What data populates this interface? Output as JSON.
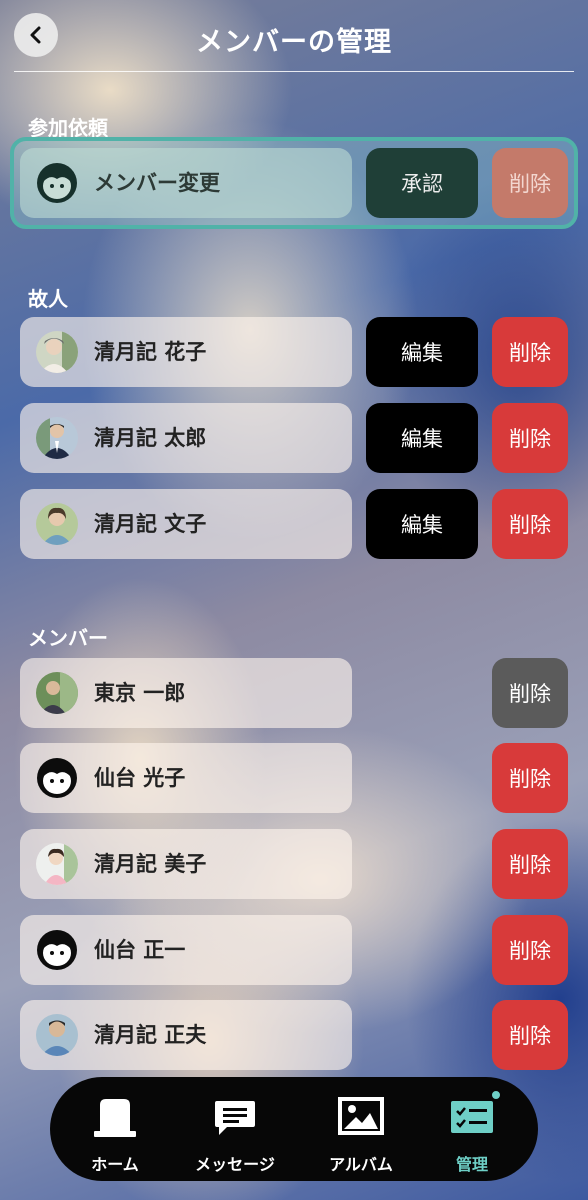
{
  "header": {
    "title": "メンバーの管理",
    "back_icon": "chevron-left-icon"
  },
  "sections": {
    "requests": "参加依頼",
    "deceased": "故人",
    "members": "メンバー"
  },
  "request": {
    "name": "メンバー変更",
    "approve_label": "承認",
    "delete_label": "削除"
  },
  "deceased": [
    {
      "name": "清月記 花子",
      "edit_label": "編集",
      "delete_label": "削除"
    },
    {
      "name": "清月記 太郎",
      "edit_label": "編集",
      "delete_label": "削除"
    },
    {
      "name": "清月記 文子",
      "edit_label": "編集",
      "delete_label": "削除"
    }
  ],
  "members": [
    {
      "name": "東京 一郎",
      "delete_label": "削除"
    },
    {
      "name": "仙台 光子",
      "delete_label": "削除"
    },
    {
      "name": "清月記 美子",
      "delete_label": "削除"
    },
    {
      "name": "仙台 正一",
      "delete_label": "削除"
    },
    {
      "name": "清月記 正夫",
      "delete_label": "削除"
    }
  ],
  "tabbar": {
    "tabs": [
      {
        "label": "ホーム",
        "icon": "home-icon"
      },
      {
        "label": "メッセージ",
        "icon": "message-icon"
      },
      {
        "label": "アルバム",
        "icon": "album-icon"
      },
      {
        "label": "管理",
        "icon": "checklist-icon"
      }
    ],
    "active_index": 3
  },
  "colors": {
    "accent": "#51b2a8",
    "delete": "#d83a3a",
    "delete_disabled": "#5b5b5b",
    "edit": "#000000",
    "approve": "#1f3f37",
    "tab_active": "#6ecfc6"
  }
}
